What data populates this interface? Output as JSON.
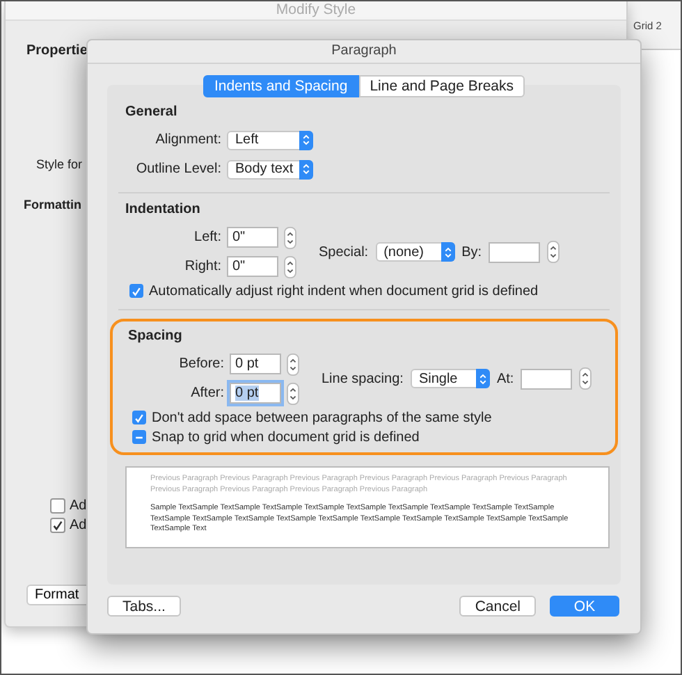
{
  "background_window": {
    "title": "Modify Style",
    "properties_label": "Propertie",
    "style_label": "Style for",
    "formatting_label": "Formattin",
    "options": [
      {
        "label": "Ad",
        "checked": false
      },
      {
        "label": "Ad",
        "checked": true
      }
    ],
    "format_button": "Format"
  },
  "behind_window": {
    "tab_label": "Grid 2"
  },
  "dialog": {
    "title": "Paragraph",
    "tabs": [
      {
        "label": "Indents and Spacing",
        "selected": true
      },
      {
        "label": "Line and Page Breaks",
        "selected": false
      }
    ],
    "general": {
      "heading": "General",
      "alignment": {
        "label": "Alignment:",
        "value": "Left"
      },
      "outline_level": {
        "label": "Outline Level:",
        "value": "Body text"
      }
    },
    "indentation": {
      "heading": "Indentation",
      "left": {
        "label": "Left:",
        "value": "0\""
      },
      "right": {
        "label": "Right:",
        "value": "0\""
      },
      "special": {
        "label": "Special:",
        "value": "(none)"
      },
      "by": {
        "label": "By:"
      },
      "options": [
        {
          "label": "Automatically adjust right indent when document grid is defined",
          "checked": true,
          "mixed": false
        }
      ]
    },
    "spacing": {
      "heading": "Spacing",
      "highlighted": true,
      "before": {
        "label": "Before:",
        "value": "0 pt",
        "selected": false
      },
      "after": {
        "label": "After:",
        "value": "0 pt",
        "selected": true
      },
      "line_spacing": {
        "label": "Line spacing:",
        "value": "Single"
      },
      "at": {
        "label": "At:"
      },
      "options": [
        {
          "label": "Don't add space between paragraphs of the same style",
          "checked": true,
          "mixed": false
        },
        {
          "label": "Snap to grid when document grid is defined",
          "checked": true,
          "mixed": true
        }
      ]
    },
    "preview": {
      "previous": "Previous Paragraph Previous Paragraph Previous Paragraph Previous Paragraph Previous Paragraph Previous Paragraph Previous Paragraph Previous Paragraph Previous Paragraph Previous Paragraph",
      "sample": "Sample TextSample TextSample TextSample TextSample TextSample TextSample TextSample TextSample TextSample TextSample TextSample TextSample TextSample TextSample TextSample TextSample TextSample TextSample TextSample TextSample Text"
    },
    "buttons": {
      "tabs": "Tabs...",
      "cancel": "Cancel",
      "ok": "OK"
    }
  }
}
